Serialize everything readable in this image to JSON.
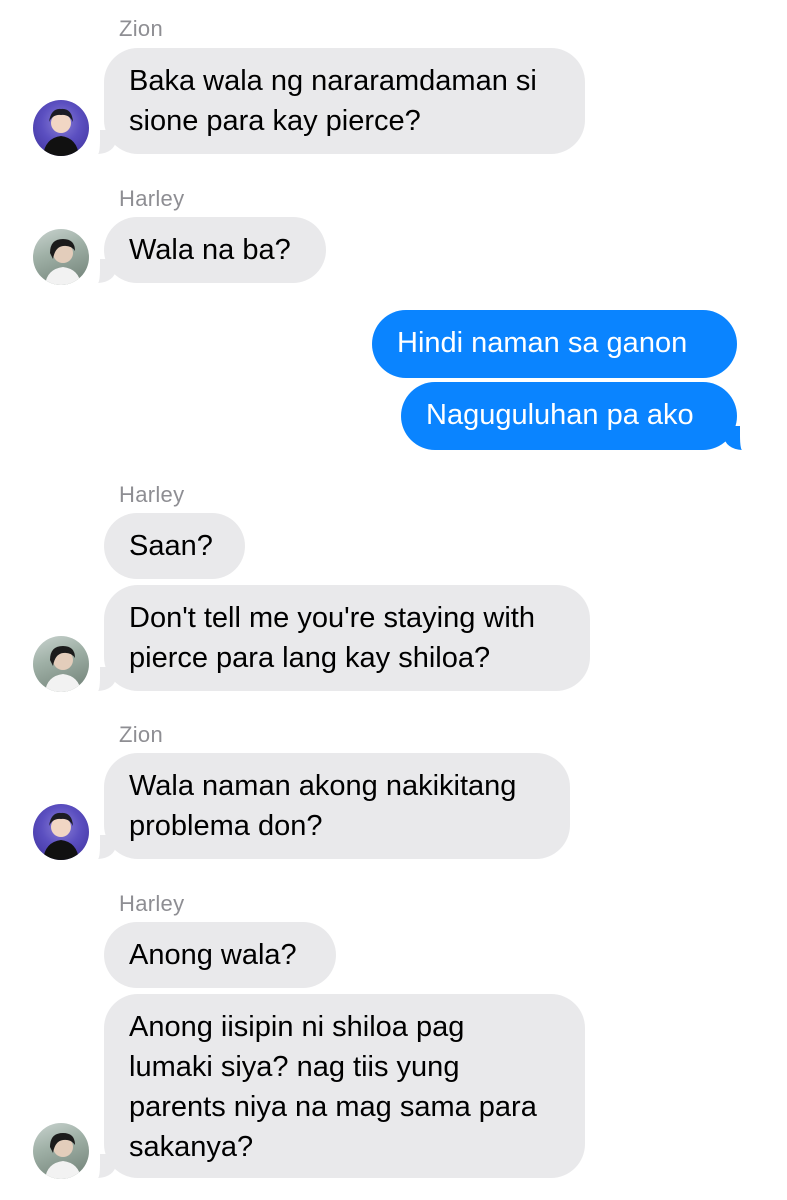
{
  "thread": {
    "messages": [
      {
        "sender": "Zion",
        "lines": [
          "Baka wala ng nararamdaman si",
          "sione para kay pierce?"
        ]
      },
      {
        "sender": "Harley",
        "lines": [
          "Wala na ba?"
        ]
      },
      {
        "sender": "me",
        "lines": [
          "Hindi naman sa ganon"
        ]
      },
      {
        "sender": "me",
        "lines": [
          "Naguguluhan pa ako"
        ]
      },
      {
        "sender": "Harley",
        "lines": [
          "Saan?"
        ]
      },
      {
        "sender": "Harley",
        "lines": [
          "Don't tell me you're staying with",
          "pierce para lang kay shiloa?"
        ]
      },
      {
        "sender": "Zion",
        "lines": [
          "Wala naman akong nakikitang",
          "problema don?"
        ]
      },
      {
        "sender": "Harley",
        "lines": [
          "Anong wala?"
        ]
      },
      {
        "sender": "Harley",
        "lines": [
          "Anong iisipin ni shiloa pag",
          "lumaki siya? nag tiis yung",
          "parents niya na mag sama para",
          "sakanya?"
        ]
      }
    ],
    "sender_labels": [
      "Zion",
      "Harley",
      "Harley",
      "Zion",
      "Harley"
    ]
  },
  "colors": {
    "incoming_bubble": "#e9e9eb",
    "outgoing_bubble": "#0a84ff",
    "sender_label": "#8e8e93"
  }
}
